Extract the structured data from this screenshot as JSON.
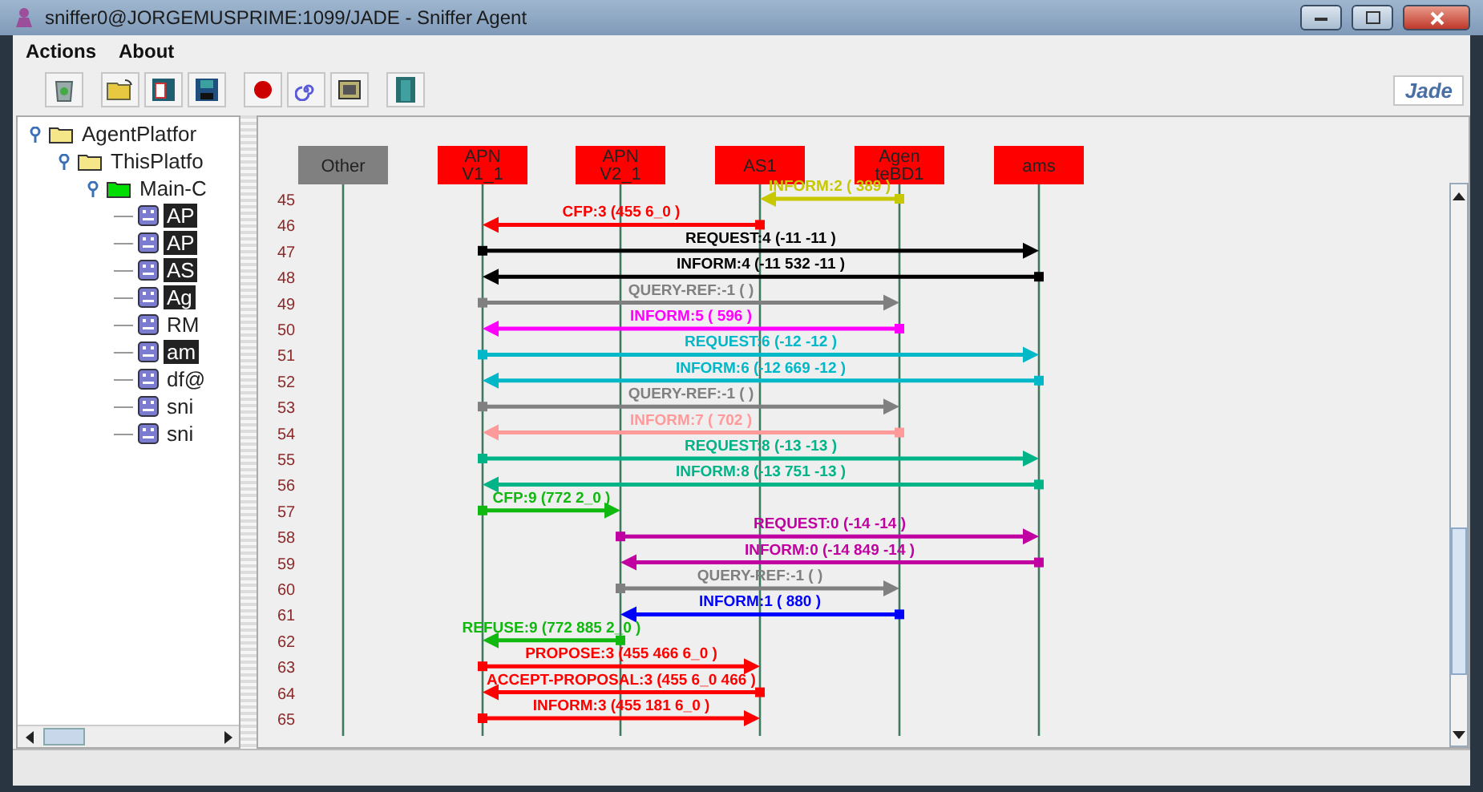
{
  "window": {
    "title": "sniffer0@JORGEMUSPRIME:1099/JADE - Sniffer Agent"
  },
  "menu": [
    "Actions",
    "About"
  ],
  "logo": "Jade",
  "tree": [
    {
      "label": "AgentPlatfor",
      "kind": "folder",
      "children": [
        {
          "label": "ThisPlatfo",
          "kind": "folder",
          "children": [
            {
              "label": "Main-C",
              "kind": "container",
              "children": [
                {
                  "label": "AP",
                  "kind": "agent",
                  "selected": true
                },
                {
                  "label": "AP",
                  "kind": "agent",
                  "selected": true
                },
                {
                  "label": "AS",
                  "kind": "agent",
                  "selected": true
                },
                {
                  "label": "Ag",
                  "kind": "agent",
                  "selected": true
                },
                {
                  "label": "RM",
                  "kind": "agent",
                  "selected": false
                },
                {
                  "label": "am",
                  "kind": "agent",
                  "selected": true
                },
                {
                  "label": "df@",
                  "kind": "agent",
                  "selected": false
                },
                {
                  "label": "sni",
                  "kind": "agent",
                  "selected": false
                },
                {
                  "label": "sni",
                  "kind": "agent",
                  "selected": false
                }
              ]
            }
          ]
        }
      ]
    }
  ],
  "agents": [
    {
      "name": "Other",
      "color": "#808080"
    },
    {
      "name": "APN V1_1",
      "color": "#ff0000"
    },
    {
      "name": "APN V2_1",
      "color": "#ff0000"
    },
    {
      "name": "AS1",
      "color": "#ff0000"
    },
    {
      "name": "Agen teBD1",
      "color": "#ff0000"
    },
    {
      "name": "ams",
      "color": "#ff0000"
    }
  ],
  "messages": [
    {
      "number": "45",
      "label": "INFORM:2 ( 389 )",
      "color": "#c8c800"
    },
    {
      "number": "46",
      "label": "CFP:3 (455 6_0 )",
      "color": "#ff0000"
    },
    {
      "number": "47",
      "label": "REQUEST:4 (-11 -11 )",
      "color": "#000000"
    },
    {
      "number": "48",
      "label": "INFORM:4 (-11 532 -11 )",
      "color": "#000000"
    },
    {
      "number": "49",
      "label": "QUERY-REF:-1 ( )",
      "color": "#808080"
    },
    {
      "number": "50",
      "label": "INFORM:5 ( 596 )",
      "color": "#ff00ff"
    },
    {
      "number": "51",
      "label": "REQUEST:6 (-12 -12 )",
      "color": "#00b8c8"
    },
    {
      "number": "52",
      "label": "INFORM:6 (-12 669 -12 )",
      "color": "#00b8c8"
    },
    {
      "number": "53",
      "label": "QUERY-REF:-1 ( )",
      "color": "#808080"
    },
    {
      "number": "54",
      "label": "INFORM:7 ( 702 )",
      "color": "#ff9a9a"
    },
    {
      "number": "55",
      "label": "REQUEST:8 (-13 -13 )",
      "color": "#00b488"
    },
    {
      "number": "56",
      "label": "INFORM:8 (-13 751 -13 )",
      "color": "#00b488"
    },
    {
      "number": "57",
      "label": "CFP:9 (772 2_0 )",
      "color": "#10b810"
    },
    {
      "number": "58",
      "label": "REQUEST:0 (-14 -14 )",
      "color": "#c000a0"
    },
    {
      "number": "59",
      "label": "INFORM:0 (-14 849 -14 )",
      "color": "#c000a0"
    },
    {
      "number": "60",
      "label": "QUERY-REF:-1 ( )",
      "color": "#808080"
    },
    {
      "number": "61",
      "label": "INFORM:1 ( 880 )",
      "color": "#0000ff"
    },
    {
      "number": "62",
      "label": "REFUSE:9 (772 885 2_0 )",
      "color": "#10b810"
    },
    {
      "number": "63",
      "label": "PROPOSE:3 (455 466 6_0 )",
      "color": "#ff0000"
    },
    {
      "number": "64",
      "label": "ACCEPT-PROPOSAL:3 (455 6_0 466 )",
      "color": "#ff0000"
    },
    {
      "number": "65",
      "label": "INFORM:3 (455 181 6_0 )",
      "color": "#ff0000"
    }
  ]
}
